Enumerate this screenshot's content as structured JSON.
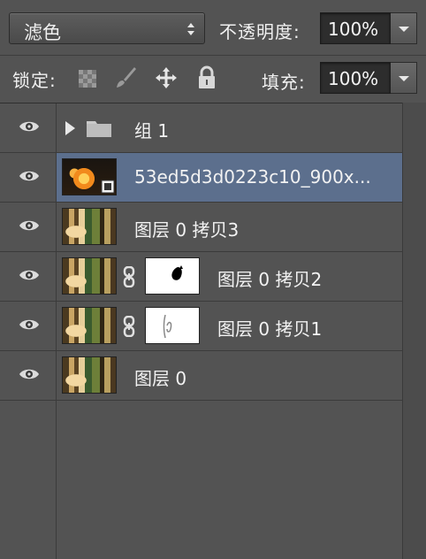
{
  "blend_mode": {
    "value": "滤色"
  },
  "opacity": {
    "label": "不透明度:",
    "value": "100%"
  },
  "lock": {
    "label": "锁定:"
  },
  "fill": {
    "label": "填充:",
    "value": "100%"
  },
  "layers": [
    {
      "type": "group",
      "name": "组 1",
      "visible": true
    },
    {
      "type": "smart",
      "name": "53ed5d3d0223c10_900x...",
      "visible": true,
      "selected": true
    },
    {
      "type": "layer",
      "name": "图层 0 拷贝3",
      "visible": true
    },
    {
      "type": "masked",
      "name": "图层 0 拷贝2",
      "visible": true
    },
    {
      "type": "masked",
      "name": "图层 0 拷贝1",
      "visible": true
    },
    {
      "type": "layer",
      "name": "图层 0",
      "visible": true
    }
  ],
  "colors": {
    "panel": "#535353",
    "selected_row": "#5c6f8d",
    "field": "#2d2d2d"
  }
}
